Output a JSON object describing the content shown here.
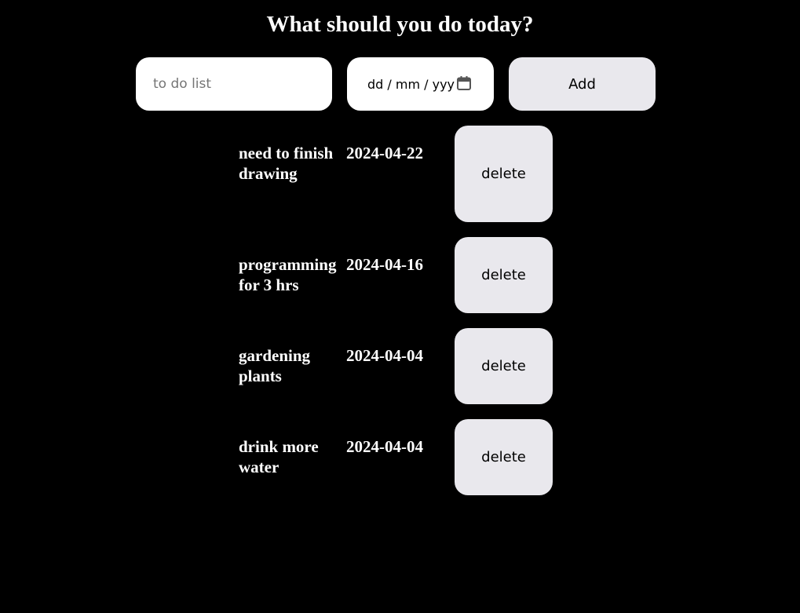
{
  "heading": "What should you do today?",
  "form": {
    "task_placeholder": "to do list",
    "date_placeholder": "dd / mm / yyyy",
    "add_label": "Add"
  },
  "todos": [
    {
      "text": "need to finish drawing",
      "date": "2024-04-22",
      "delete_label": "delete"
    },
    {
      "text": "programming for 3 hrs",
      "date": "2024-04-16",
      "delete_label": "delete"
    },
    {
      "text": "gardening plants",
      "date": "2024-04-04",
      "delete_label": "delete"
    },
    {
      "text": "drink more water",
      "date": "2024-04-04",
      "delete_label": "delete"
    }
  ],
  "colors": {
    "background": "#000000",
    "text": "#ffffff",
    "button": "#e9e8ed",
    "input": "#ffffff"
  }
}
